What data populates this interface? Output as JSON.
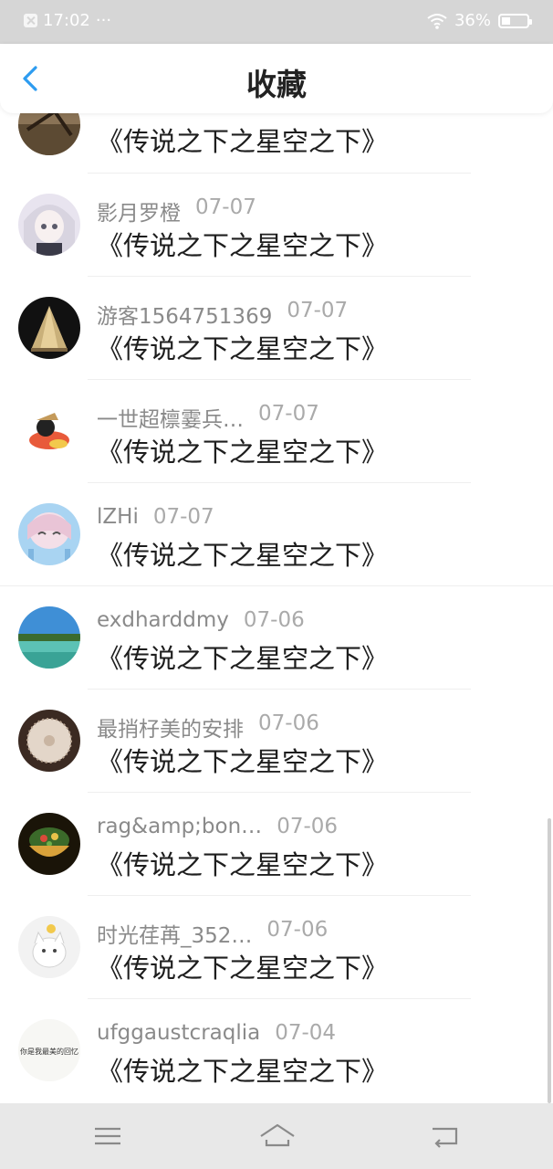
{
  "status_bar": {
    "time": "17:02",
    "dots": "···",
    "battery": "36%",
    "battery_level": 0.36
  },
  "header": {
    "title": "收藏"
  },
  "list": [
    {
      "user": "",
      "date": "",
      "title": "《传说之下之星空之下》"
    },
    {
      "user": "影月罗橙",
      "date": "07-07",
      "title": "《传说之下之星空之下》"
    },
    {
      "user": "游客1564751369",
      "date": "07-07",
      "title": "《传说之下之星空之下》"
    },
    {
      "user": "一世超檩霎兵…",
      "date": "07-07",
      "title": "《传说之下之星空之下》"
    },
    {
      "user": "lZHi",
      "date": "07-07",
      "title": "《传说之下之星空之下》"
    },
    {
      "user": "exdharddmy",
      "date": "07-06",
      "title": "《传说之下之星空之下》"
    },
    {
      "user": "最捎杍美的安排",
      "date": "07-06",
      "title": "《传说之下之星空之下》"
    },
    {
      "user": "rag&amp;bon…",
      "date": "07-06",
      "title": "《传说之下之星空之下》"
    },
    {
      "user": "时光荏苒_352…",
      "date": "07-06",
      "title": "《传说之下之星空之下》"
    },
    {
      "user": "ufggaustcraqlia",
      "date": "07-04",
      "title": "《传说之下之星空之下》"
    }
  ],
  "avatar_text": "你是我最美的回忆",
  "colors": {
    "accent": "#2d9cf0",
    "status_bar": "#d6d6d6",
    "nav_bar": "#e8e8e8"
  },
  "icons": [
    "back-arrow-icon",
    "wifi-icon",
    "battery-icon",
    "menu-icon",
    "home-icon",
    "return-icon"
  ]
}
